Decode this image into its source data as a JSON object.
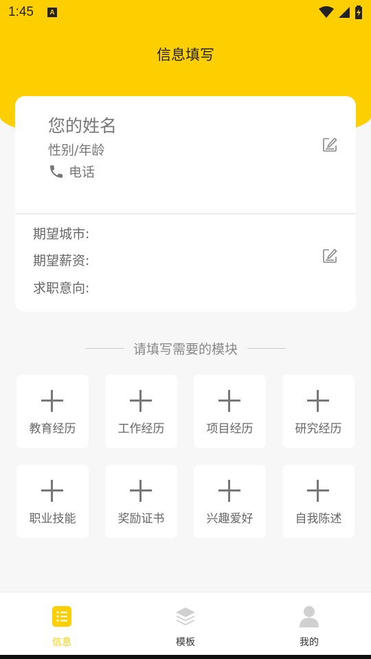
{
  "status": {
    "time": "1:45",
    "notification_icon": "A"
  },
  "header": {
    "title": "信息填写"
  },
  "profile": {
    "name_placeholder": "您的姓名",
    "gender_age_placeholder": "性别/年龄",
    "phone_label": "电话",
    "phone_icon": "phone-icon"
  },
  "expectations": {
    "city_label": "期望城市:",
    "salary_label": "期望薪资:",
    "intent_label": "求职意向:"
  },
  "modules": {
    "heading": "请填写需要的模块",
    "items": [
      {
        "label": "教育经历"
      },
      {
        "label": "工作经历"
      },
      {
        "label": "项目经历"
      },
      {
        "label": "研究经历"
      },
      {
        "label": "职业技能"
      },
      {
        "label": "奖励证书"
      },
      {
        "label": "兴趣爱好"
      },
      {
        "label": "自我陈述"
      }
    ]
  },
  "tabbar": {
    "items": [
      {
        "label": "信息",
        "active": true
      },
      {
        "label": "模板",
        "active": false
      },
      {
        "label": "我的",
        "active": false
      }
    ]
  },
  "colors": {
    "accent": "#fecf00",
    "background": "#f7f7f7",
    "text_muted": "#777777"
  }
}
